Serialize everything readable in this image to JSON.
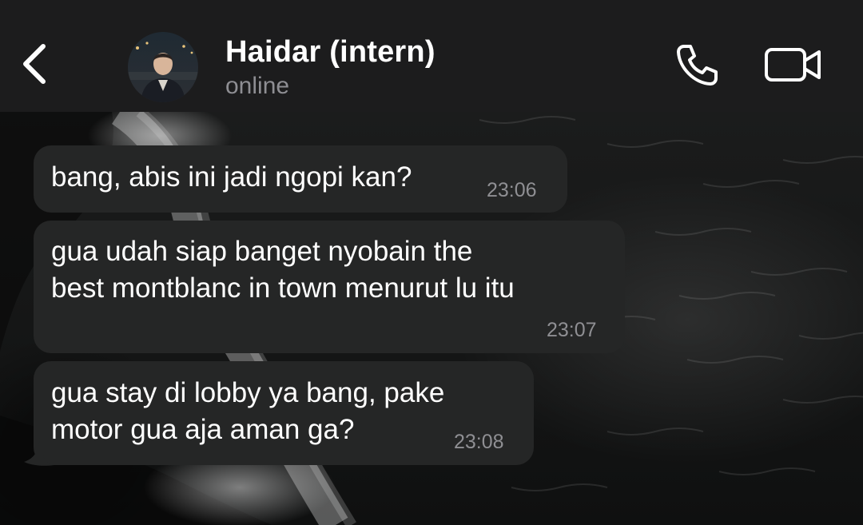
{
  "header": {
    "contact_name": "Haidar (intern)",
    "status": "online",
    "back_icon": "chevron-left-icon",
    "call_icon": "phone-icon",
    "video_icon": "video-camera-icon"
  },
  "messages": [
    {
      "lines": [
        "bang, abis ini jadi ngopi kan?"
      ],
      "time": "23:06",
      "direction": "incoming"
    },
    {
      "lines": [
        "gua udah siap banget nyobain the",
        "best montblanc in town menurut lu itu"
      ],
      "time": "23:07",
      "direction": "incoming"
    },
    {
      "lines": [
        "gua stay di lobby ya bang, pake",
        "motor gua aja aman ga?"
      ],
      "time": "23:08",
      "direction": "incoming"
    }
  ],
  "colors": {
    "header_bg": "#1c1c1d",
    "bubble_bg": "#252626",
    "text": "#ffffff",
    "secondary_text": "#8e8e93"
  }
}
